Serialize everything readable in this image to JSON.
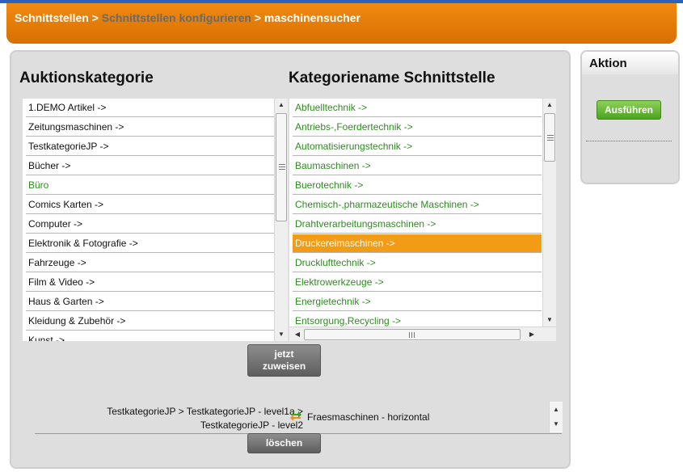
{
  "breadcrumb": {
    "item1": "Schnittstellen",
    "sep1": " > ",
    "item2": "Schnittstellen konfigurieren",
    "sep2": " > ",
    "item3": "maschinensucher"
  },
  "left": {
    "title": "Auktionskategorie",
    "items": [
      {
        "label": "1.DEMO Artikel ->"
      },
      {
        "label": "Zeitungsmaschinen ->"
      },
      {
        "label": "TestkategorieJP ->"
      },
      {
        "label": "Bücher ->"
      },
      {
        "label": "Büro"
      },
      {
        "label": "Comics Karten ->"
      },
      {
        "label": "Computer ->"
      },
      {
        "label": "Elektronik & Fotografie ->"
      },
      {
        "label": "Fahrzeuge ->"
      },
      {
        "label": "Film & Video ->"
      },
      {
        "label": "Haus & Garten ->"
      },
      {
        "label": "Kleidung & Zubehör ->"
      },
      {
        "label": "Kunst ->"
      }
    ]
  },
  "right": {
    "title": "Kategoriename Schnittstelle",
    "items": [
      {
        "label": "Abfuelltechnik ->"
      },
      {
        "label": "Antriebs-,Foerdertechnik ->"
      },
      {
        "label": "Automatisierungstechnik ->"
      },
      {
        "label": "Baumaschinen ->"
      },
      {
        "label": "Buerotechnik ->"
      },
      {
        "label": "Chemisch-,pharmazeutische Maschinen ->"
      },
      {
        "label": "Drahtverarbeitungsmaschinen ->"
      },
      {
        "label": "Druckereimaschinen ->"
      },
      {
        "label": "Drucklufttechnik ->"
      },
      {
        "label": "Elektrowerkzeuge ->"
      },
      {
        "label": "Energietechnik ->"
      },
      {
        "label": "Entsorgung,Recycling ->"
      }
    ]
  },
  "assign_button": {
    "line1": "jetzt",
    "line2": "zuweisen"
  },
  "assignment": {
    "path_line1": "TestkategorieJP > TestkategorieJP - level1a >",
    "path_line2": "TestkategorieJP - level2",
    "target": "Fraesmaschinen - horizontal"
  },
  "delete_button": "löschen",
  "action": {
    "title": "Aktion",
    "run_button": "Ausführen"
  },
  "colors": {
    "accent": "#f29b15",
    "link_green": "#2e8b20",
    "header_orange": "#e47c05"
  }
}
